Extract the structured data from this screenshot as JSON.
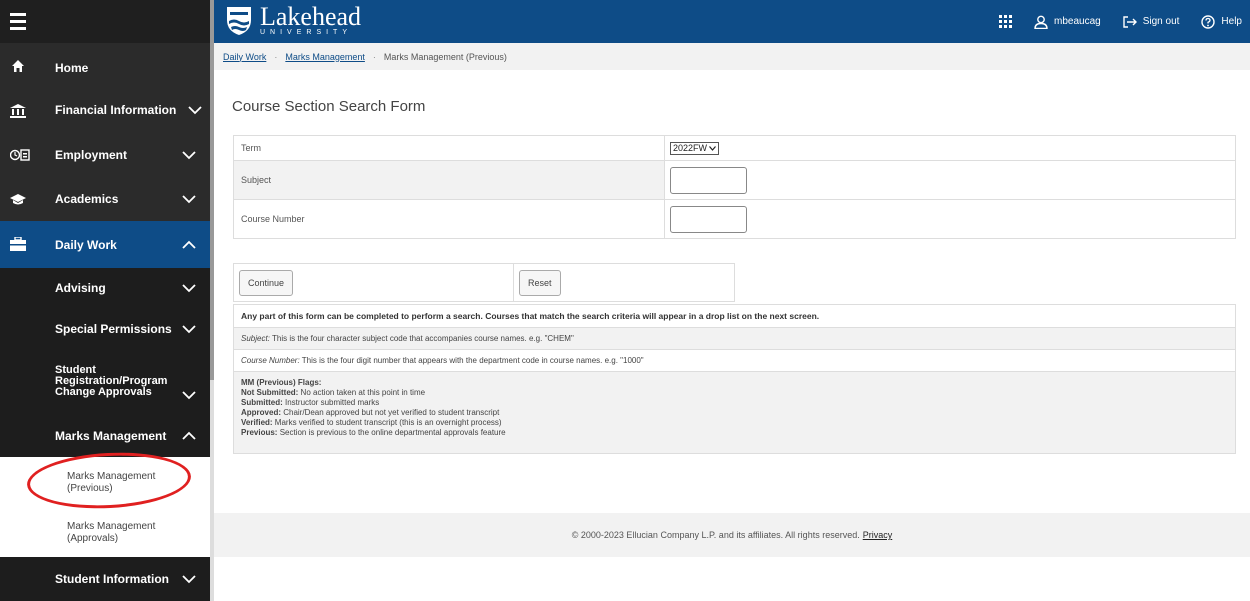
{
  "header": {
    "logo_name": "Lakehead",
    "logo_sub": "UNIVERSITY",
    "user": "mbeaucag",
    "sign_out": "Sign out",
    "help": "Help",
    "brand_color": "#0e4c87"
  },
  "sidebar": {
    "items": [
      {
        "label": "Home",
        "icon": "home-icon"
      },
      {
        "label": "Financial Information",
        "icon": "bank-icon"
      },
      {
        "label": "Employment",
        "icon": "employment-icon"
      },
      {
        "label": "Academics",
        "icon": "graduation-cap-icon"
      },
      {
        "label": "Daily Work",
        "icon": "briefcase-icon"
      },
      {
        "label": "Advising"
      },
      {
        "label": "Special Permissions"
      },
      {
        "label": "Student Registration/Program Change Approvals"
      },
      {
        "label": "Marks Management"
      },
      {
        "label": "Student Information"
      }
    ],
    "sub_links": [
      "Marks Management (Previous)",
      "Marks Management (Approvals)"
    ]
  },
  "breadcrumb": {
    "items": [
      "Daily Work",
      "Marks Management",
      "Marks Management (Previous)"
    ]
  },
  "page": {
    "title": "Course Section Search Form"
  },
  "form": {
    "term_label": "Term",
    "term_value": "2022FW",
    "subject_label": "Subject",
    "course_label": "Course Number"
  },
  "buttons": {
    "continue": "Continue",
    "reset": "Reset"
  },
  "info": {
    "intro": "Any part of this form can be completed to perform a search. Courses that match the search criteria will appear in a drop list on the next screen.",
    "subject_key": "Subject:",
    "subject_text": " This is the four character subject code that accompanies course names. e.g. \"CHEM\"",
    "course_key": "Course Number:",
    "course_text": " This is the four digit number that appears with the department code in course names. e.g. \"1000\"",
    "flags_title": "MM (Previous) Flags:",
    "flags": [
      {
        "key": "Not Submitted:",
        "text": " No action taken at this point in time"
      },
      {
        "key": "Submitted:",
        "text": " Instructor submitted marks"
      },
      {
        "key": "Approved:",
        "text": " Chair/Dean approved but not yet verified to student transcript"
      },
      {
        "key": "Verified:",
        "text": " Marks verified to student transcript (this is an overnight process)"
      },
      {
        "key": "Previous:",
        "text": " Section is previous to the online departmental approvals feature"
      }
    ]
  },
  "footer": {
    "copyright": "© 2000-2023 Ellucian Company L.P. and its affiliates. All rights reserved.",
    "privacy": "Privacy"
  }
}
